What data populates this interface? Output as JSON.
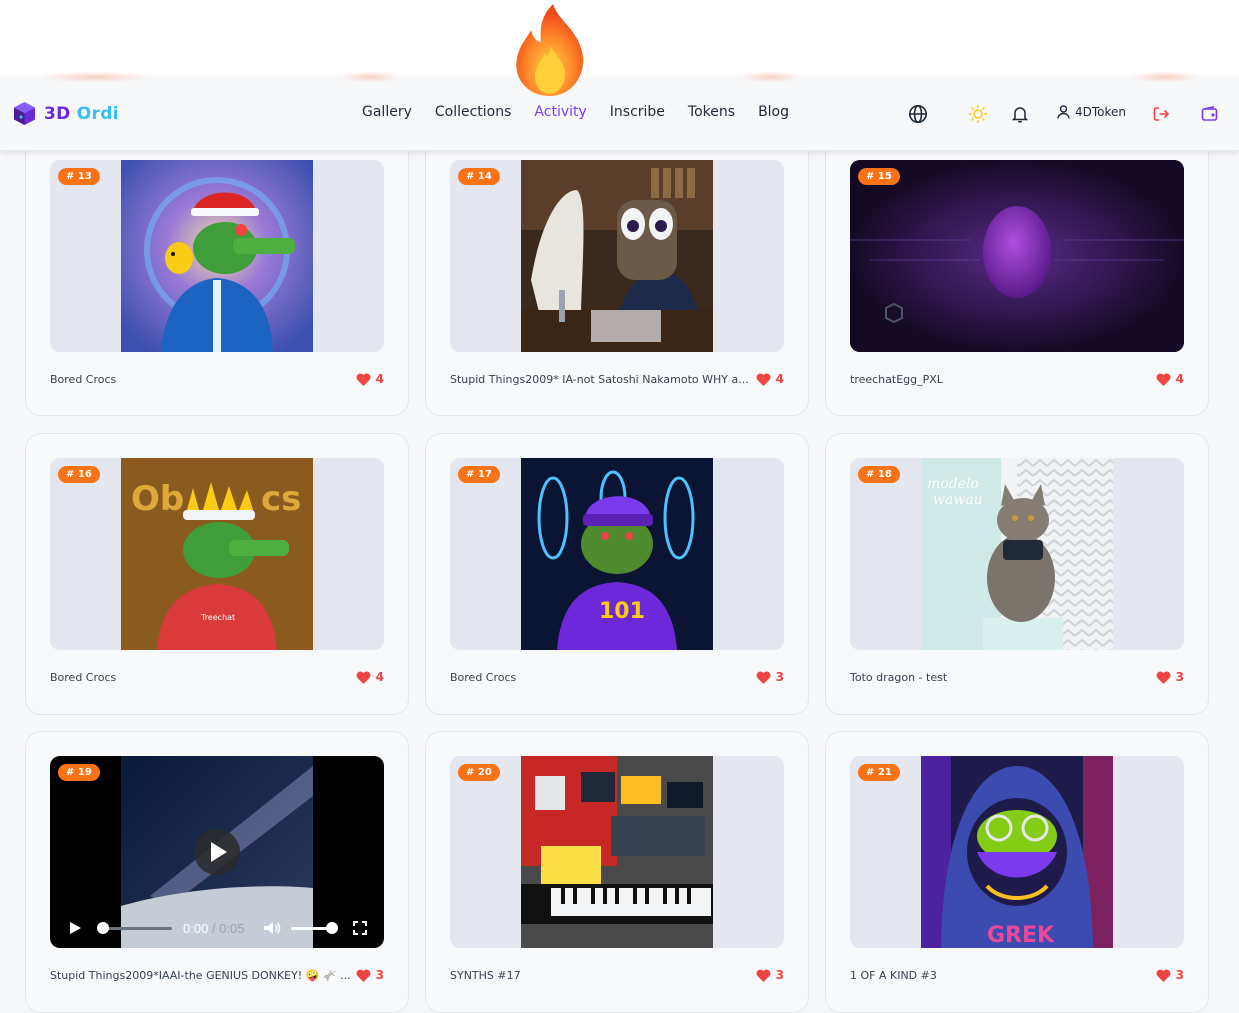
{
  "brand": {
    "name_part1": "3D",
    "name_part2": "Ordi"
  },
  "nav": [
    {
      "label": "Gallery",
      "active": false
    },
    {
      "label": "Collections",
      "active": false
    },
    {
      "label": "Activity",
      "active": true
    },
    {
      "label": "Inscribe",
      "active": false
    },
    {
      "label": "Tokens",
      "active": false
    },
    {
      "label": "Blog",
      "active": false
    }
  ],
  "header_icons": [
    "globe-icon",
    "sun-icon",
    "bell-icon",
    "user-icon",
    "logout-icon",
    "wallet-icon"
  ],
  "user": {
    "name": "4DToken"
  },
  "colors": {
    "accent": "#7c3aed",
    "badge": "#f97316",
    "like": "#ef4444"
  },
  "cards": [
    {
      "badge": "# 13",
      "title": "Bored Crocs",
      "likes": "4"
    },
    {
      "badge": "# 14",
      "title": "Stupid Things2009* IA-not Satoshi Nakamoto WHY a...",
      "likes": "4"
    },
    {
      "badge": "# 15",
      "title": "treechatEgg_PXL",
      "likes": "4"
    },
    {
      "badge": "# 16",
      "title": "Bored Crocs",
      "likes": "4"
    },
    {
      "badge": "# 17",
      "title": "Bored Crocs",
      "likes": "3"
    },
    {
      "badge": "# 18",
      "title": "Toto dragon - test",
      "likes": "3"
    },
    {
      "badge": "# 19",
      "title": "Stupid Things2009*IAAI-the GENIUS DONKEY! 🤪 🫏 ...",
      "likes": "3"
    },
    {
      "badge": "# 20",
      "title": "SYNTHS #17",
      "likes": "3"
    },
    {
      "badge": "# 21",
      "title": "1 OF A KIND #3",
      "likes": "3"
    }
  ],
  "video": {
    "current": "0:00",
    "separator": "/",
    "duration": "0:05"
  }
}
